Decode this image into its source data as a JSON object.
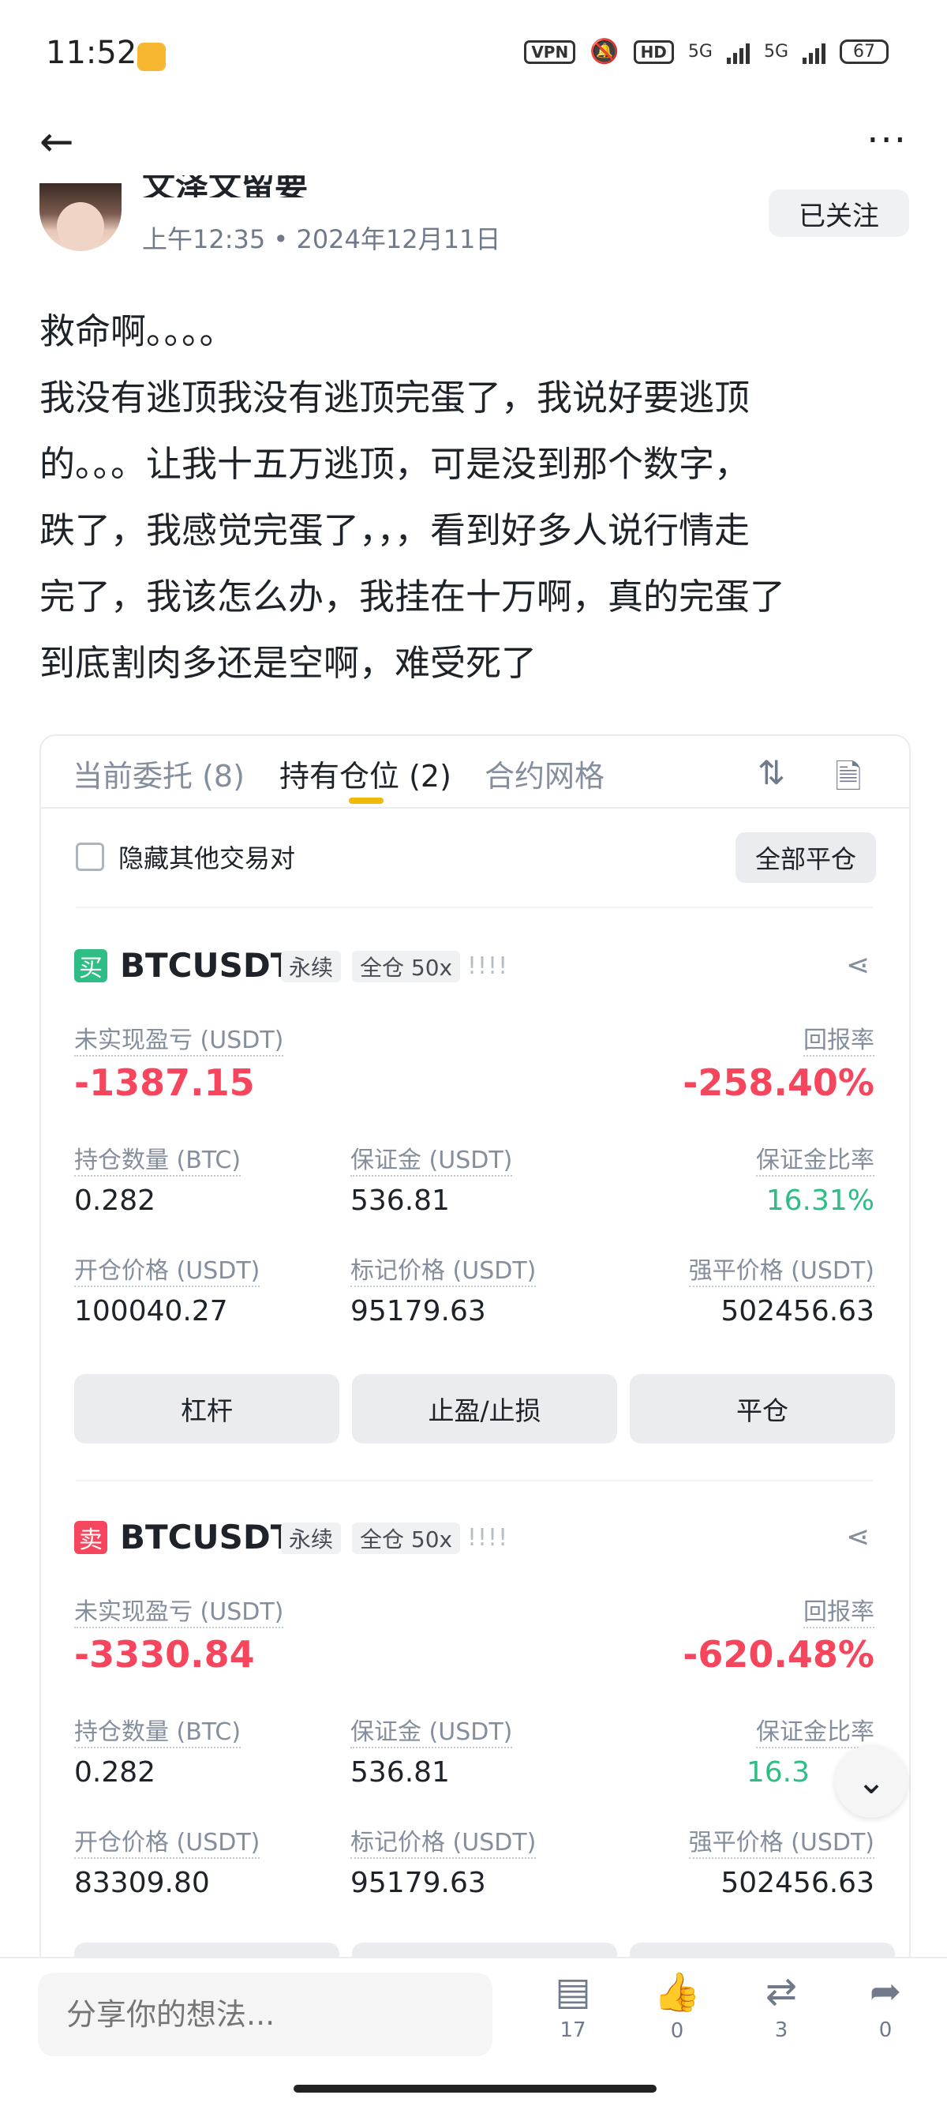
{
  "status_bar": {
    "time": "11:52",
    "vpn": "VPN",
    "hd": "HD",
    "net1": "5G",
    "net2": "5G",
    "battery": "67"
  },
  "nav": {
    "back_icon": "arrow-left-icon",
    "more_icon": "more-icon"
  },
  "author": {
    "name": "文泽文留要",
    "time": "上午12:35",
    "date": "2024年12月11日",
    "follow_label": "已关注"
  },
  "post": {
    "text": "救命啊。。。。\n我没有逃顶我没有逃顶完蛋了，我说好要逃顶\n的。。。让我十五万逃顶，可是没到那个数字，\n跌了，我感觉完蛋了，，，看到好多人说行情走\n完了，我该怎么办，我挂在十万啊，真的完蛋了\n到底割肉多还是空啊，难受死了"
  },
  "card": {
    "tabs": [
      "当前委托 (8)",
      "持有仓位 (2)",
      "合约网格"
    ],
    "active_tab": 1,
    "hide_pairs_label": "隐藏其他交易对",
    "close_all_label": "全部平仓",
    "labels": {
      "unrealized_pnl": "未实现盈亏 (USDT)",
      "roe": "回报率",
      "size": "持仓数量 (BTC)",
      "margin": "保证金 (USDT)",
      "margin_ratio": "保证金比率",
      "entry_price": "开仓价格 (USDT)",
      "mark_price": "标记价格 (USDT)",
      "liq_price": "强平价格 (USDT)"
    },
    "buttons": {
      "leverage": "杠杆",
      "tpsl": "止盈/止损",
      "close": "平仓"
    },
    "positions": [
      {
        "side": "买",
        "symbol": "BTCUSDT",
        "type_tag": "永续",
        "margin_tag": "全仓 50x",
        "unrealized_pnl": "-1387.15",
        "roe": "-258.40%",
        "size": "0.282",
        "margin": "536.81",
        "margin_ratio": "16.31%",
        "entry_price": "100040.27",
        "mark_price": "95179.63",
        "liq_price": "502456.63"
      },
      {
        "side": "卖",
        "symbol": "BTCUSDT",
        "type_tag": "永续",
        "margin_tag": "全仓 50x",
        "unrealized_pnl": "-3330.84",
        "roe": "-620.48%",
        "size": "0.282",
        "margin": "536.81",
        "margin_ratio": "16.3",
        "entry_price": "83309.80",
        "mark_price": "95179.63",
        "liq_price": "502456.63"
      }
    ]
  },
  "bottom_bar": {
    "placeholder": "分享你的想法...",
    "comments": "17",
    "likes": "0",
    "reposts": "3",
    "shares": "0"
  },
  "colors": {
    "negative": "#f6465d",
    "positive": "#2ebd85",
    "accent": "#f0b90b"
  }
}
